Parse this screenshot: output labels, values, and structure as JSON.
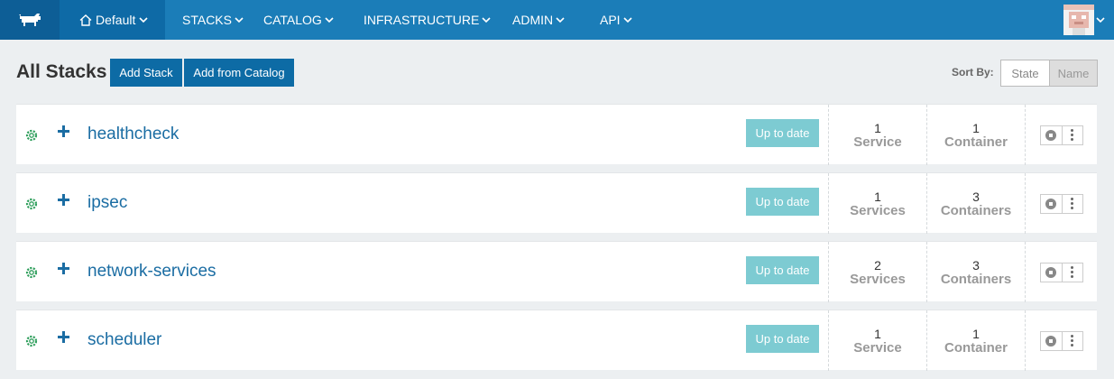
{
  "nav": {
    "environment": "Default",
    "items": [
      {
        "label": "STACKS"
      },
      {
        "label": "CATALOG"
      },
      {
        "label": "INFRASTRUCTURE"
      },
      {
        "label": "ADMIN"
      },
      {
        "label": "API"
      }
    ]
  },
  "header": {
    "title": "All Stacks",
    "add_stack": "Add Stack",
    "add_from_catalog": "Add from Catalog",
    "sort_by": "Sort By:",
    "sort_options": [
      "State",
      "Name"
    ],
    "sort_active": "Name"
  },
  "stacks": [
    {
      "name": "healthcheck",
      "status": "Up to date",
      "services_count": "1",
      "services_label": "Service",
      "containers_count": "1",
      "containers_label": "Container"
    },
    {
      "name": "ipsec",
      "status": "Up to date",
      "services_count": "1",
      "services_label": "Services",
      "containers_count": "3",
      "containers_label": "Containers"
    },
    {
      "name": "network-services",
      "status": "Up to date",
      "services_count": "2",
      "services_label": "Services",
      "containers_count": "3",
      "containers_label": "Containers"
    },
    {
      "name": "scheduler",
      "status": "Up to date",
      "services_count": "1",
      "services_label": "Service",
      "containers_count": "1",
      "containers_label": "Container"
    }
  ],
  "colors": {
    "nav_bg": "#1b7db8",
    "primary_button": "#0d6ba5",
    "status_badge": "#7dcbd2",
    "link": "#1b6da3",
    "health_icon": "#2e9e5b"
  }
}
